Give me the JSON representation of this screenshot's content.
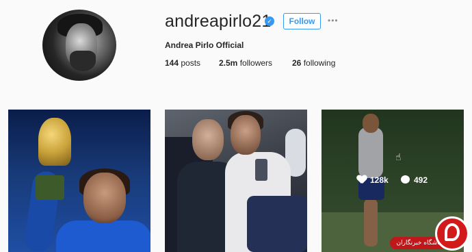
{
  "profile": {
    "username": "andreapirlo21",
    "follow_label": "Follow",
    "more_glyph": "•••",
    "full_name": "Andrea Pirlo Official",
    "stats": {
      "posts_count": "144",
      "posts_label": "posts",
      "followers_count": "2.5m",
      "followers_label": "followers",
      "following_count": "26",
      "following_label": "following"
    }
  },
  "posts": [
    {
      "image": "pirlo-world-cup-trophy"
    },
    {
      "image": "pirlo-on-airplane"
    },
    {
      "image": "pirlo-training",
      "likes": "128k",
      "comments": "492"
    }
  ],
  "watermark": {
    "text": "باشگاه خبرنگاران"
  },
  "colors": {
    "accent": "#3897f0",
    "text": "#262626",
    "background": "#fafafa",
    "watermark": "#d21a1a"
  }
}
